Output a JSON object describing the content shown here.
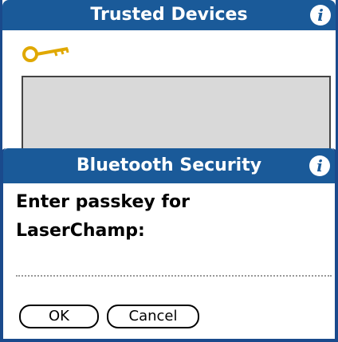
{
  "background_form": {
    "title": "Trusted Devices",
    "info_icon": "info-icon",
    "key_icon": "key-icon"
  },
  "dialog": {
    "title": "Bluetooth Security",
    "info_icon": "info-icon",
    "prompt_line1": "Enter passkey for",
    "prompt_line2": "LaserChamp:",
    "passkey_value": "",
    "ok_label": "OK",
    "cancel_label": "Cancel"
  },
  "colors": {
    "titlebar": "#1a5a99",
    "key": "#e0a800",
    "list_background": "#d9d9d9"
  }
}
